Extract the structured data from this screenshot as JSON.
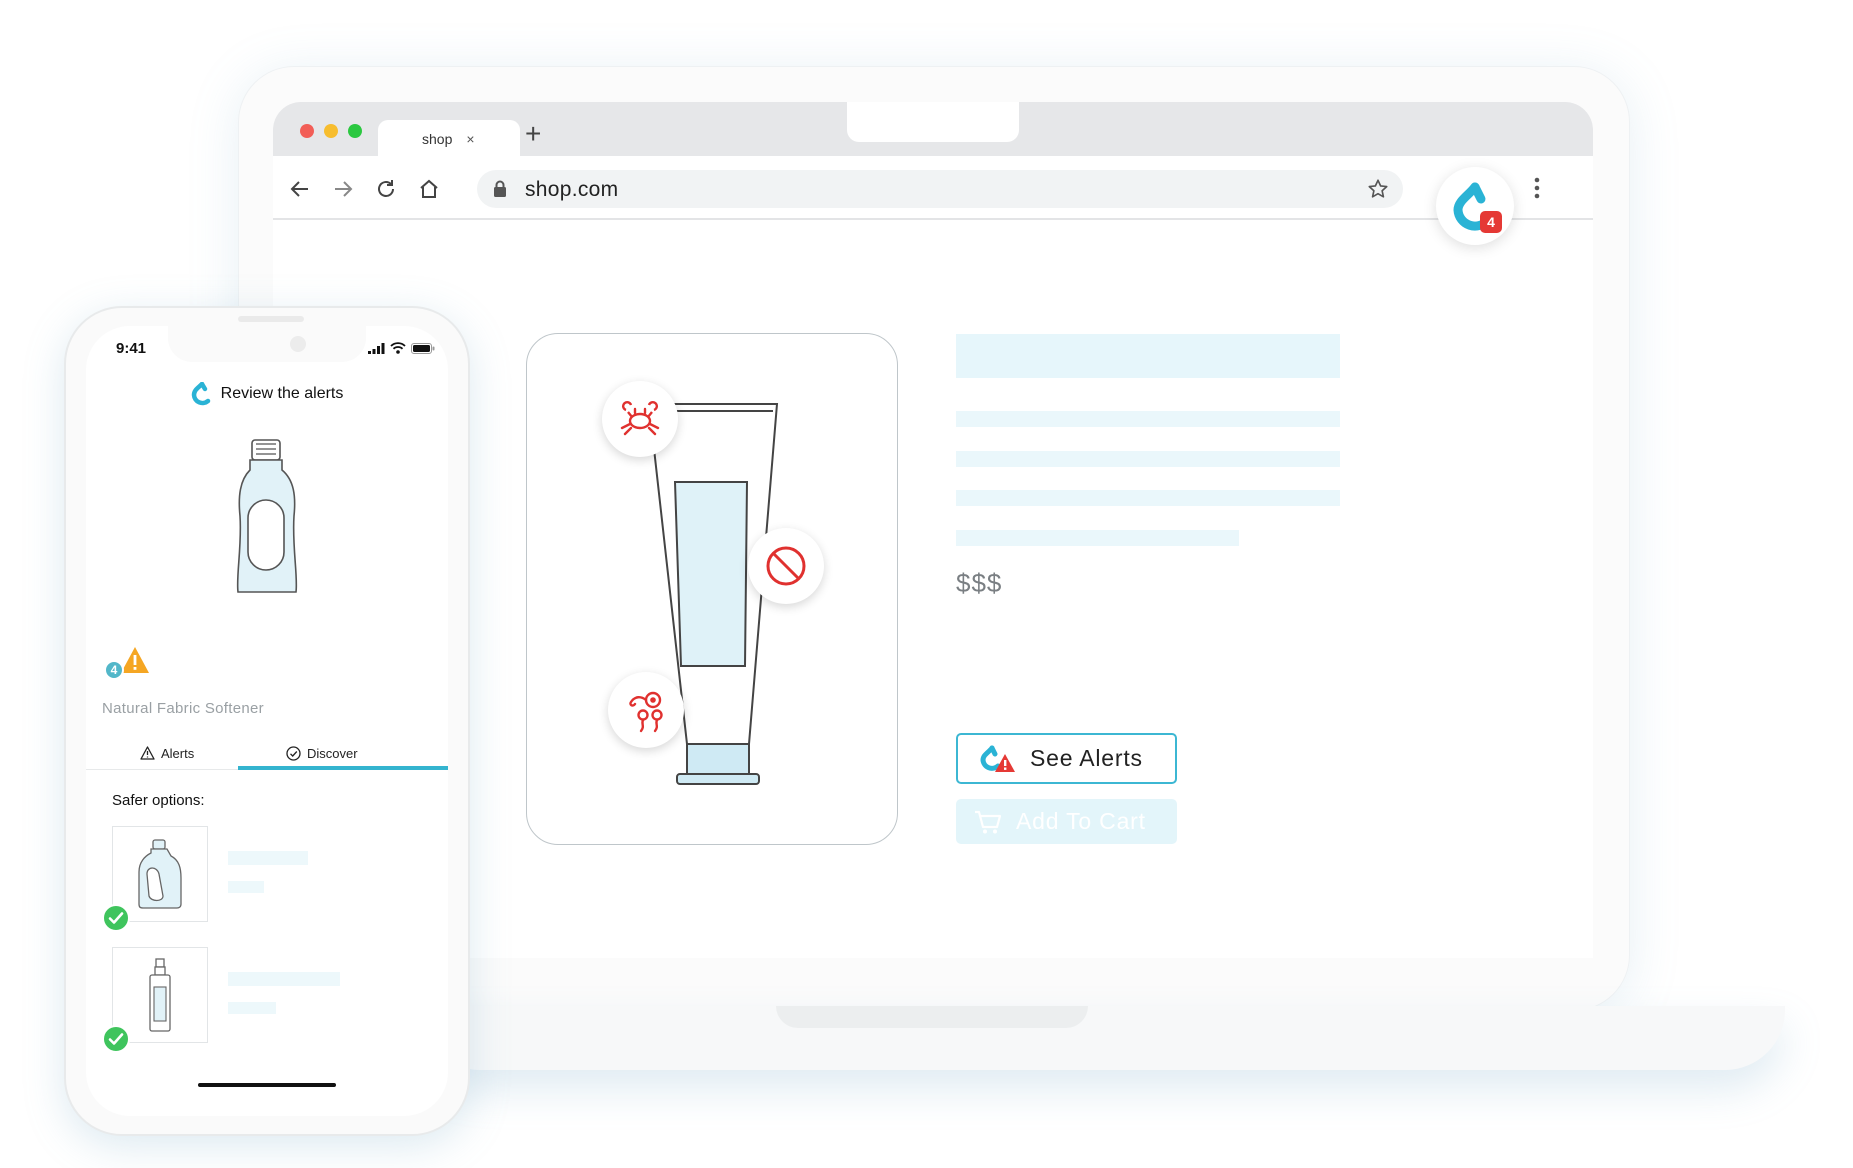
{
  "browser": {
    "tab_title": "shop",
    "tab_close": "×",
    "new_tab": "+",
    "url": "shop.com",
    "extension_badge": "4"
  },
  "product_page": {
    "price": "$$$",
    "see_alerts_label": "See Alerts",
    "add_to_cart_label": "Add To Cart",
    "alert_icons": [
      "crab-icon",
      "prohibited-icon",
      "reproductive-icon"
    ]
  },
  "phone": {
    "time": "9:41",
    "header_title": "Review the alerts",
    "alert_count": "4",
    "product_name": "Natural Fabric Softener",
    "tabs": [
      {
        "label": "Alerts",
        "icon": "warning-outline-icon"
      },
      {
        "label": "Discover",
        "icon": "check-circle-icon"
      }
    ],
    "active_tab": "Discover",
    "safer_options_label": "Safer options:"
  },
  "colors": {
    "accent": "#34b4cf",
    "alert_red": "#e53935",
    "warning_orange": "#f5a623",
    "success_green": "#3fc45d"
  }
}
